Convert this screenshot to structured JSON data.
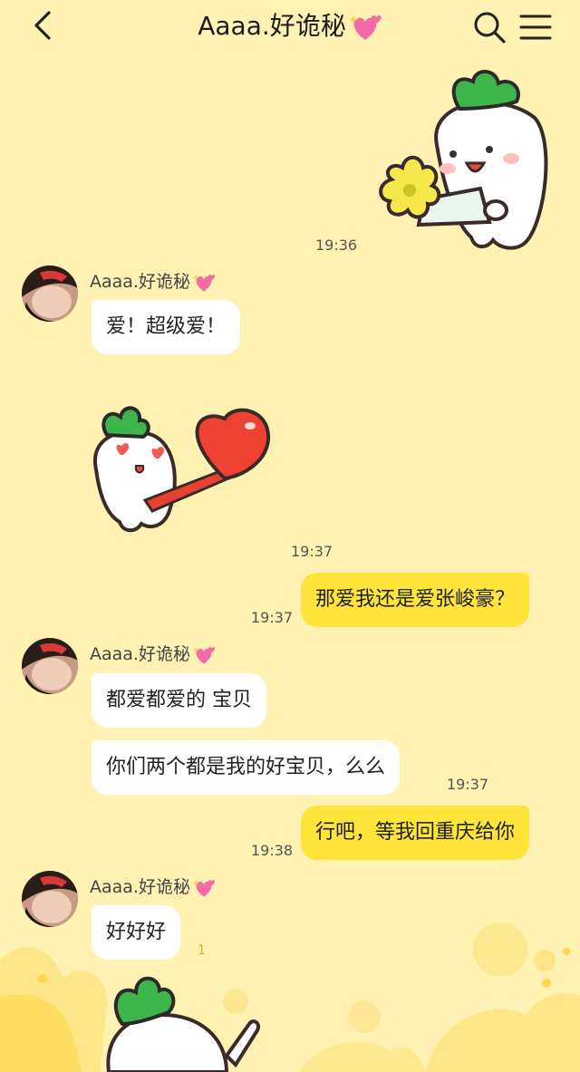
{
  "header": {
    "title": "Aaaa.好诡秘"
  },
  "messages": [
    {
      "side": "right",
      "type": "sticker",
      "sticker": "radish-holding-flowers",
      "time": "19:36"
    },
    {
      "side": "left",
      "sender": "Aaaa.好诡秘",
      "type": "text",
      "text": "爱！超级爱！"
    },
    {
      "side": "left",
      "type": "sticker",
      "sticker": "radish-heart-eyes-with-heart",
      "time": "19:37"
    },
    {
      "side": "right",
      "type": "text",
      "text": "那爱我还是爱张峻豪？",
      "time": "19:37"
    },
    {
      "side": "left",
      "sender": "Aaaa.好诡秘",
      "type": "text",
      "text": "都爱都爱的 宝贝"
    },
    {
      "side": "left",
      "type": "text",
      "text": "你们两个都是我的好宝贝，么么",
      "time": "19:37"
    },
    {
      "side": "right",
      "type": "text",
      "text": "行吧，等我回重庆给你",
      "time": "19:38"
    },
    {
      "side": "left",
      "sender": "Aaaa.好诡秘",
      "type": "text",
      "text": "好好好",
      "read_count": "1"
    },
    {
      "side": "left",
      "type": "sticker",
      "sticker": "radish-waving"
    }
  ],
  "colors": {
    "background": "#FFF2B3",
    "my_bubble": "#FFE43A",
    "their_bubble": "#FFFFFF"
  }
}
